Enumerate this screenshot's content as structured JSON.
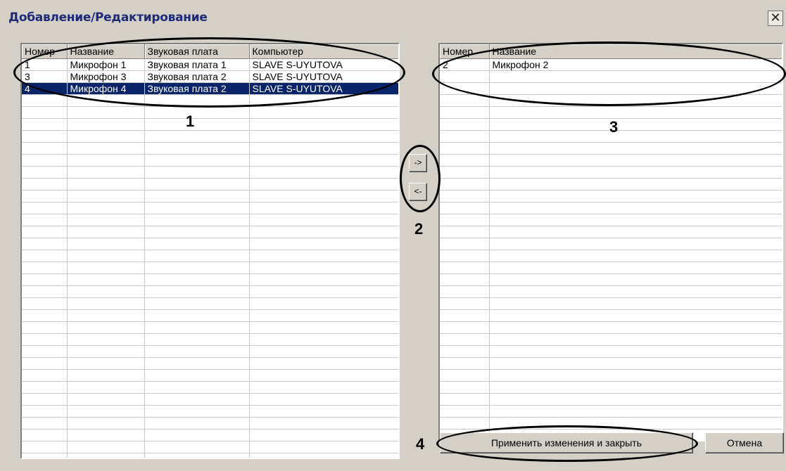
{
  "window": {
    "title": "Добавление/Редактирование",
    "close_glyph": "✕"
  },
  "left_list": {
    "columns": [
      "Номер",
      "Название",
      "Звуковая плата",
      "Компьютер"
    ],
    "rows": [
      [
        "1",
        "Микрофон 1",
        "Звуковая плата 1",
        "SLAVE S-UYUTOVA"
      ],
      [
        "3",
        "Микрофон 3",
        "Звуковая плата 2",
        "SLAVE S-UYUTOVA"
      ],
      [
        "4",
        "Микрофон 4",
        "Звуковая плата 2",
        "SLAVE S-UYUTOVA"
      ]
    ],
    "selected_row": 2
  },
  "right_list": {
    "columns": [
      "Номер",
      "Название"
    ],
    "rows": [
      [
        "2",
        "Микрофон 2"
      ]
    ]
  },
  "move_buttons": {
    "add_label": "->",
    "remove_label": "<-"
  },
  "buttons": {
    "apply_label": "Применить изменения и закрыть",
    "cancel_label": "Отмена"
  },
  "callouts": {
    "c1": "1",
    "c2": "2",
    "c3": "3",
    "c4": "4"
  },
  "colors": {
    "selection": "#0a246a",
    "title_text": "#1e2a78",
    "dialog_bg": "#d4d0c8"
  }
}
